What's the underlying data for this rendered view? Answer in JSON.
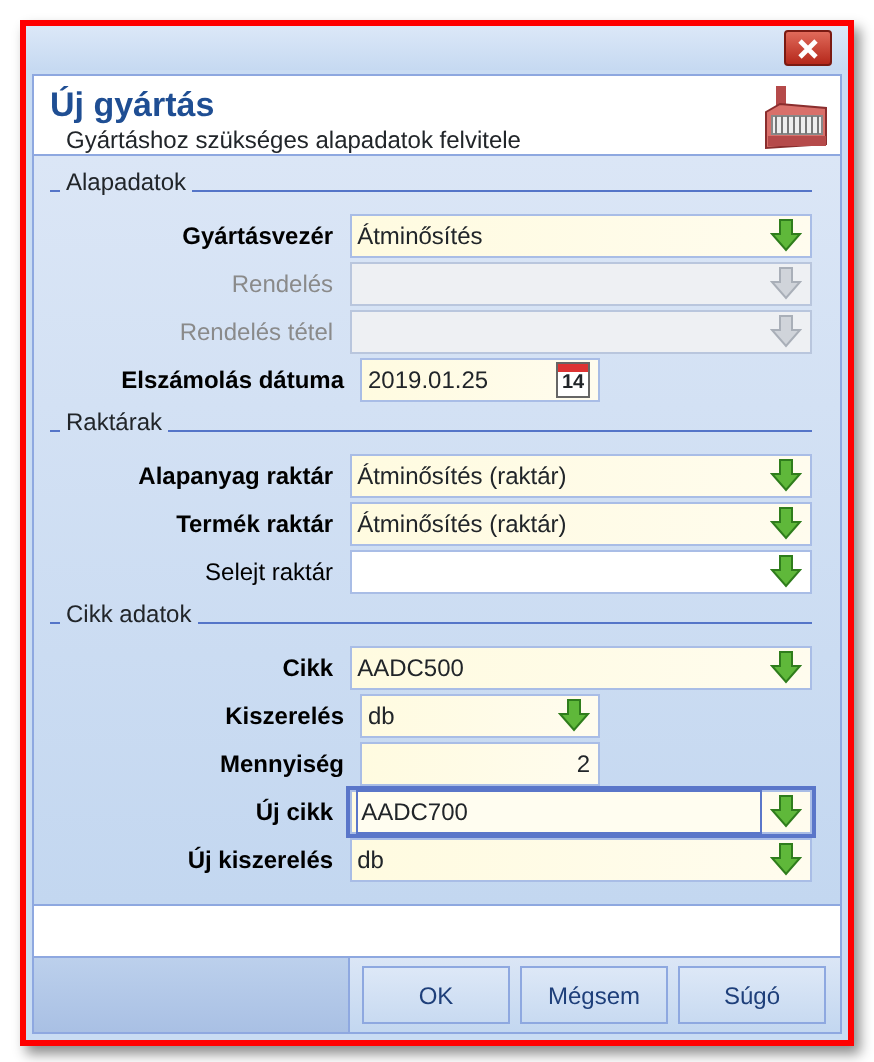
{
  "window": {
    "title": "Új gyártás",
    "subtitle": "Gyártáshoz szükséges alapadatok felvitele"
  },
  "sections": [
    {
      "title": "Alapadatok",
      "fields": [
        {
          "label": "Gyártásvezér",
          "value": "Átminősítés",
          "kind": "combo",
          "required": true,
          "disabled": false,
          "short": false,
          "focused": false
        },
        {
          "label": "Rendelés",
          "kind": "combo",
          "required": false,
          "disabled": true,
          "short": false,
          "focused": false
        },
        {
          "label": "Rendelés tétel",
          "kind": "combo",
          "required": false,
          "disabled": true,
          "short": false,
          "focused": false
        },
        {
          "label": "Elszámolás dátuma",
          "value": "2019.01.25",
          "calendar_day": "14",
          "kind": "date",
          "required": true,
          "disabled": false,
          "short": true,
          "focused": false
        }
      ]
    },
    {
      "title": "Raktárak",
      "fields": [
        {
          "label": "Alapanyag raktár",
          "value": "Átminősítés (raktár)",
          "kind": "combo",
          "required": true,
          "disabled": false,
          "short": false,
          "focused": false
        },
        {
          "label": "Termék raktár",
          "value": "Átminősítés (raktár)",
          "kind": "combo",
          "required": true,
          "disabled": false,
          "short": false,
          "focused": false
        },
        {
          "label": "Selejt raktár",
          "kind": "combo",
          "required": false,
          "disabled": false,
          "short": false,
          "focused": false
        }
      ]
    },
    {
      "title": "Cikk adatok",
      "fields": [
        {
          "label": "Cikk",
          "value": "AADC500",
          "kind": "combo",
          "required": true,
          "disabled": false,
          "short": false,
          "focused": false
        },
        {
          "label": "Kiszerelés",
          "value": "db",
          "kind": "combo",
          "required": true,
          "disabled": false,
          "short": true,
          "focused": false
        },
        {
          "label": "Mennyiség",
          "value": "2",
          "kind": "number",
          "required": true,
          "disabled": false,
          "short": true,
          "focused": false
        },
        {
          "label": "Új cikk",
          "value": "AADC700",
          "kind": "combo",
          "required": true,
          "disabled": false,
          "short": false,
          "focused": true
        },
        {
          "label": "Új kiszerelés",
          "value": "db",
          "kind": "combo",
          "required": true,
          "disabled": false,
          "short": false,
          "focused": false
        }
      ]
    }
  ],
  "buttons": [
    "OK",
    "Mégsem",
    "Súgó"
  ]
}
